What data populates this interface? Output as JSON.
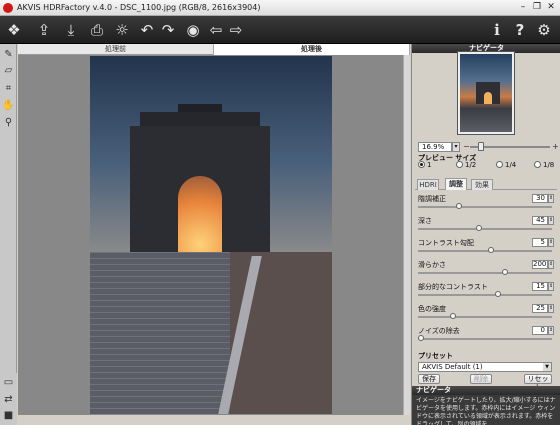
{
  "window": {
    "title": "AKVIS HDRFactory v.4.0 - DSC_1100.jpg (RGB/8, 2616x3904)",
    "minimize": "–",
    "restore": "❐",
    "close": "✕"
  },
  "toolbar": {
    "left": [
      {
        "name": "enhance-icon",
        "glyph": "❖"
      },
      {
        "name": "open-icon",
        "glyph": "⇪"
      },
      {
        "name": "save-icon",
        "glyph": "⤓"
      },
      {
        "name": "print-icon",
        "glyph": "⎙"
      },
      {
        "name": "export-icon",
        "glyph": "☼"
      },
      {
        "name": "undo-icon",
        "glyph": "↶"
      },
      {
        "name": "redo-icon",
        "glyph": "↷"
      },
      {
        "name": "eye-icon",
        "glyph": "◉"
      },
      {
        "name": "back-icon",
        "glyph": "⇦"
      },
      {
        "name": "forward-icon",
        "glyph": "⇨"
      }
    ],
    "right": [
      {
        "name": "info-icon",
        "glyph": "i"
      },
      {
        "name": "help-icon",
        "glyph": "?"
      },
      {
        "name": "settings-icon",
        "glyph": "⚙"
      }
    ]
  },
  "leftTools": [
    {
      "name": "brush-icon",
      "glyph": "✎"
    },
    {
      "name": "eraser-icon",
      "glyph": "▱"
    },
    {
      "name": "crop-icon",
      "glyph": "⌗"
    },
    {
      "name": "hand-icon",
      "glyph": "✋"
    },
    {
      "name": "zoom-icon",
      "glyph": "⚲"
    }
  ],
  "bottomTools": [
    {
      "name": "view-single-icon",
      "glyph": "▭"
    },
    {
      "name": "view-swap-icon",
      "glyph": "⇄"
    },
    {
      "name": "view-dark-icon",
      "glyph": "■"
    }
  ],
  "tabs": {
    "before": "処理前",
    "after": "処理後"
  },
  "navigator": {
    "header": "ナビゲータ",
    "zoom": "16.9%",
    "zoom_minus": "−",
    "zoom_plus": "+"
  },
  "preview": {
    "title": "プレビュー サイズ",
    "options": [
      "1",
      "1/2",
      "1/4",
      "1/8"
    ],
    "selected": "1"
  },
  "panelTabs": [
    "HDRI",
    "調整",
    "効果"
  ],
  "activePanelTab": "調整",
  "params": [
    {
      "label": "階調補正",
      "value": "30",
      "level": 0.3
    },
    {
      "label": "深さ",
      "value": "45",
      "level": 0.45
    },
    {
      "label": "コントラスト勾配",
      "value": "5",
      "level": 0.55
    },
    {
      "label": "滑らかさ",
      "value": "200",
      "level": 0.66
    },
    {
      "label": "部分的なコントラスト",
      "value": "15",
      "level": 0.6
    },
    {
      "label": "色の強度",
      "value": "25",
      "level": 0.25
    },
    {
      "label": "ノイズの除去",
      "value": "0",
      "level": 0.0
    }
  ],
  "presets": {
    "title": "プリセット",
    "selected": "AKVIS Default (1)",
    "save": "保存",
    "delete": "削除",
    "reset": "リセット"
  },
  "hint": {
    "header": "ナビゲータ",
    "text": "イメージをナビゲートしたり、拡大/縮小するにはナビゲータを使用します。赤枠内にはイメージ ウィンドウに表示されている領域が表示されます。赤枠をドラッグして、別の領域を"
  }
}
